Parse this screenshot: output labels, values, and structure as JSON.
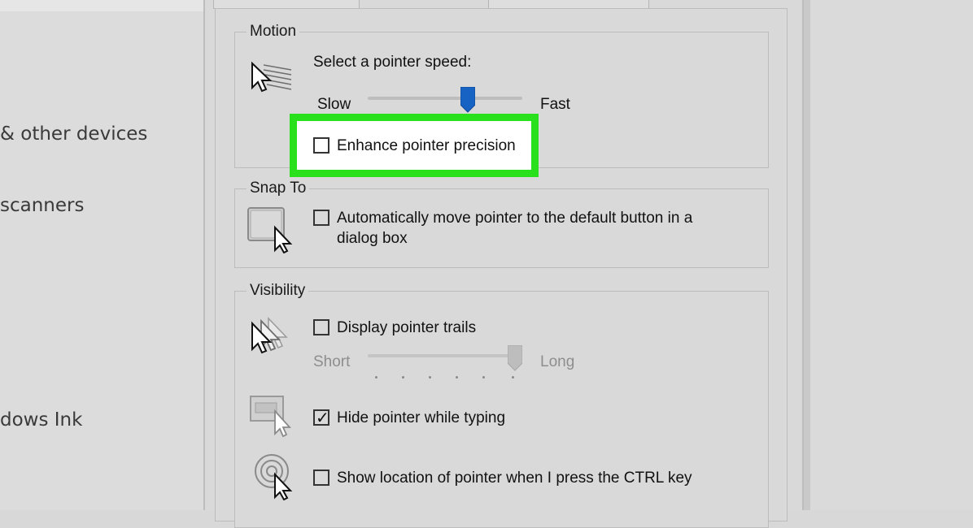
{
  "sidebar": {
    "items": [
      {
        "label": "& other devices"
      },
      {
        "label": "scanners"
      },
      {
        "label": "dows Ink"
      }
    ]
  },
  "motion": {
    "title": "Motion",
    "speed_label": "Select a pointer speed:",
    "slow_label": "Slow",
    "fast_label": "Fast",
    "speed_level_percent": 66,
    "precision_label": "Enhance pointer precision",
    "precision_checked": false
  },
  "snap_to": {
    "title": "Snap To",
    "option_line1": "Automatically move pointer to the default button in a",
    "option_line2": "dialog box",
    "checked": false
  },
  "visibility": {
    "title": "Visibility",
    "trails_label": "Display pointer trails",
    "trails_checked": false,
    "short_label": "Short",
    "long_label": "Long",
    "trail_length_percent": 100,
    "hide_label": "Hide pointer while typing",
    "hide_checked": true,
    "show_ctrl_label": "Show location of pointer when I press the CTRL key",
    "show_ctrl_checked": false
  },
  "colors": {
    "highlight": "#28e11c",
    "slider_thumb": "#1763c4"
  }
}
